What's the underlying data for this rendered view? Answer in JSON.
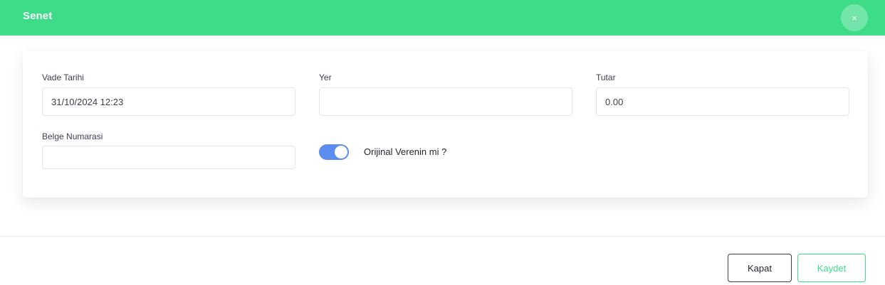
{
  "header": {
    "title": "Senet",
    "close_icon": "×"
  },
  "form": {
    "vade_tarihi": {
      "label": "Vade Tarihi",
      "value": "31/10/2024 12:23"
    },
    "yer": {
      "label": "Yer",
      "value": ""
    },
    "tutar": {
      "label": "Tutar",
      "value": "0.00"
    },
    "belge_numarasi": {
      "label": "Belge Numarasi",
      "value": ""
    },
    "orijinal_verenin_mi": {
      "label": "Orijinal Verenin mi ?",
      "checked": true
    }
  },
  "footer": {
    "close_label": "Kapat",
    "save_label": "Kaydet"
  },
  "colors": {
    "header": "#3ddc89",
    "toggle_on": "#5b8def",
    "save_accent": "#3ddc89"
  }
}
